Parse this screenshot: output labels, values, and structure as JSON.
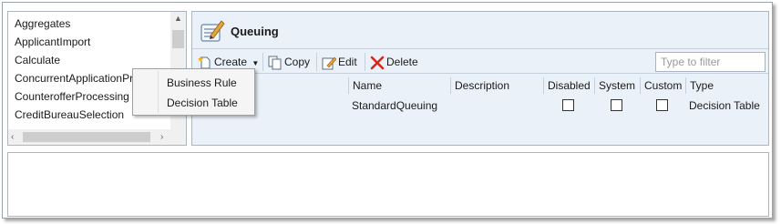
{
  "list": {
    "items": [
      "Aggregates",
      "ApplicantImport",
      "Calculate",
      "ConcurrentApplicationProcessing",
      "CounterofferProcessing",
      "CreditBureauSelection"
    ]
  },
  "panel": {
    "title": "Queuing"
  },
  "toolbar": {
    "create_label": "Create",
    "copy_label": "Copy",
    "edit_label": "Edit",
    "delete_label": "Delete",
    "filter_placeholder": "Type to filter"
  },
  "grid": {
    "columns": [
      "Name",
      "Description",
      "Disabled",
      "System",
      "Custom",
      "Type"
    ],
    "rows": [
      {
        "name": "StandardQueuing",
        "description": "",
        "disabled": false,
        "system": false,
        "custom": false,
        "type": "Decision Table"
      }
    ]
  },
  "create_menu": {
    "items": [
      "Business Rule",
      "Decision Table"
    ]
  },
  "colors": {
    "panel_bg": "#eaf1f8",
    "border": "#adb6c0",
    "delete_red": "#d9261c"
  },
  "icons": {
    "title": "queue-edit-icon",
    "create": "new-document-icon",
    "copy": "copy-icon",
    "edit": "edit-icon",
    "delete": "delete-x-icon"
  }
}
